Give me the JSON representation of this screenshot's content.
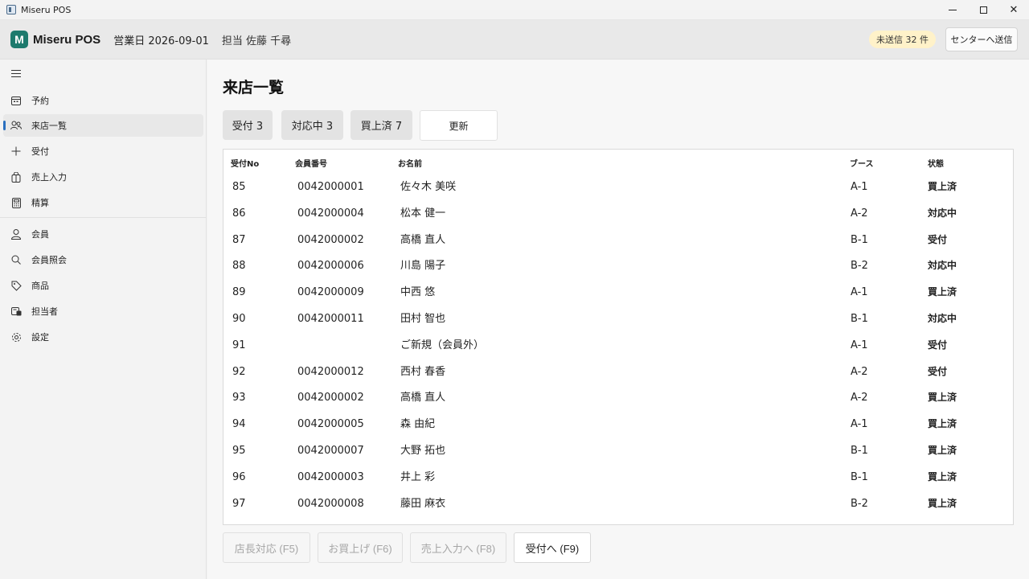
{
  "window": {
    "title": "Miseru POS",
    "minimize": "",
    "maximize": "",
    "close": "✕"
  },
  "header": {
    "brand": "Miseru POS",
    "logo_letter": "M",
    "business_day": "営業日 2026-09-01",
    "staff": "担当 佐藤 千尋",
    "unsent_badge": "未送信 32 件",
    "send_button": "センターへ送信",
    "logo_color": "#1d7a6d",
    "badge_color": "#fff2c9"
  },
  "sidebar": {
    "items": [
      {
        "label": "予約",
        "icon": "calendar-icon",
        "active": false
      },
      {
        "label": "来店一覧",
        "icon": "people-icon",
        "active": true
      },
      {
        "label": "受付",
        "icon": "plus-icon",
        "active": false
      },
      {
        "label": "売上入力",
        "icon": "shopping-bag-icon",
        "active": false
      },
      {
        "label": "精算",
        "icon": "calculator-icon",
        "active": false
      },
      {
        "label": "会員",
        "icon": "person-icon",
        "active": false
      },
      {
        "label": "会員照会",
        "icon": "search-icon",
        "active": false
      },
      {
        "label": "商品",
        "icon": "tag-icon",
        "active": false
      },
      {
        "label": "担当者",
        "icon": "badge-icon",
        "active": false
      },
      {
        "label": "設定",
        "icon": "gear-icon",
        "active": false
      }
    ],
    "accent_color": "#2a6fbf"
  },
  "main": {
    "title": "来店一覧",
    "tabs": [
      {
        "label": "受付 3"
      },
      {
        "label": "対応中 3"
      },
      {
        "label": "買上済 7"
      }
    ],
    "refresh_button": "更新",
    "table": {
      "headers": [
        "受付No",
        "会員番号",
        "お名前",
        "ブース",
        "状態"
      ],
      "rows": [
        [
          "85",
          "0042000001",
          "佐々木 美咲",
          "A-1",
          "買上済"
        ],
        [
          "86",
          "0042000004",
          "松本 健一",
          "A-2",
          "対応中"
        ],
        [
          "87",
          "0042000002",
          "高橋 直人",
          "B-1",
          "受付"
        ],
        [
          "88",
          "0042000006",
          "川島 陽子",
          "B-2",
          "対応中"
        ],
        [
          "89",
          "0042000009",
          "中西 悠",
          "A-1",
          "買上済"
        ],
        [
          "90",
          "0042000011",
          "田村 智也",
          "B-1",
          "対応中"
        ],
        [
          "91",
          "",
          "ご新規（会員外）",
          "A-1",
          "受付"
        ],
        [
          "92",
          "0042000012",
          "西村 春香",
          "A-2",
          "受付"
        ],
        [
          "93",
          "0042000002",
          "高橋 直人",
          "A-2",
          "買上済"
        ],
        [
          "94",
          "0042000005",
          "森 由紀",
          "A-1",
          "買上済"
        ],
        [
          "95",
          "0042000007",
          "大野 拓也",
          "B-1",
          "買上済"
        ],
        [
          "96",
          "0042000003",
          "井上 彩",
          "B-1",
          "買上済"
        ],
        [
          "97",
          "0042000008",
          "藤田 麻衣",
          "B-2",
          "買上済"
        ]
      ]
    },
    "actions": [
      {
        "label": "店長対応 (F5)",
        "enabled": false
      },
      {
        "label": "お買上げ (F6)",
        "enabled": false
      },
      {
        "label": "売上入力へ (F8)",
        "enabled": false
      },
      {
        "label": "受付へ (F9)",
        "enabled": true
      }
    ]
  }
}
